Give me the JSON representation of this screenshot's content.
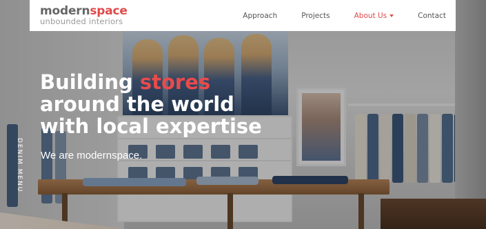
{
  "brand": {
    "name_part1": "modern",
    "name_part2": "space",
    "tagline": "unbounded interiors"
  },
  "nav": {
    "items": [
      {
        "label": "Approach",
        "active": false
      },
      {
        "label": "Projects",
        "active": false
      },
      {
        "label": "About Us",
        "active": true,
        "has_dropdown": true
      },
      {
        "label": "Contact",
        "active": false
      }
    ]
  },
  "hero": {
    "line1_prefix": "Building ",
    "line1_accent": "stores",
    "line2": "around the world",
    "line3": "with local expertise",
    "subtitle": "We are modernspace."
  },
  "background_sign": "DENIM MENU",
  "colors": {
    "accent": "#e04a4a",
    "logo_grey": "#666666",
    "tagline_grey": "#9a9a9a",
    "nav_text": "#555555",
    "navbar_bg": "#ffffff"
  },
  "icons": {
    "dropdown": "caret-down-icon"
  }
}
